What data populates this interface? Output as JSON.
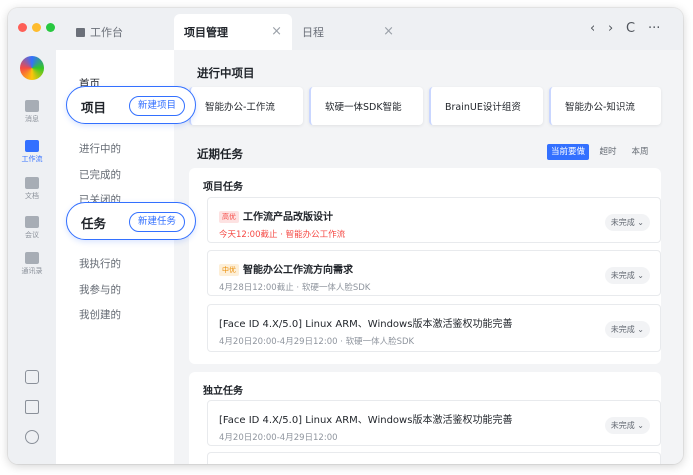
{
  "tabs": [
    {
      "label": "工作台",
      "icon": "grid-icon"
    },
    {
      "label": "项目管理",
      "close": "×"
    },
    {
      "label": "日程",
      "close": "×"
    }
  ],
  "window_controls": {
    "back": "‹",
    "forward": "›",
    "refresh": "C",
    "more": "···"
  },
  "rail": [
    {
      "label": "消息",
      "icon": "message-icon"
    },
    {
      "label": "工作流",
      "icon": "workflow-icon",
      "active": true
    },
    {
      "label": "文档",
      "icon": "doc-icon"
    },
    {
      "label": "会议",
      "icon": "video-icon"
    },
    {
      "label": "通讯录",
      "icon": "contacts-icon"
    }
  ],
  "rail_bottom_icons": [
    "phone-icon",
    "note-icon",
    "more-icon"
  ],
  "nav": {
    "home": "首页",
    "project_group": {
      "title": "项目",
      "button": "新建项目"
    },
    "project_items": [
      "进行中的",
      "已完成的",
      "已关闭的"
    ],
    "task_group": {
      "title": "任务",
      "button": "新建任务"
    },
    "task_items": [
      "我执行的",
      "我参与的",
      "我创建的"
    ]
  },
  "ongoing": {
    "title": "进行中项目",
    "projects": [
      "智能办公-工作流",
      "软硬一体SDK智能",
      "BrainUE设计组资",
      "智能办公-知识流"
    ]
  },
  "recent": {
    "title": "近期任务",
    "filters": [
      "当前要做",
      "超时",
      "本周"
    ],
    "active_filter": "当前要做",
    "project_tasks_title": "项目任务",
    "independent_tasks_title": "独立任务",
    "project_tasks": [
      {
        "priority": "高优",
        "name": "工作流产品改版设计",
        "meta": "今天12:00截止 · 智能办公工作流",
        "status": "未完成 ⌄"
      },
      {
        "priority": "中优",
        "name": "智能办公工作流方向需求",
        "meta": "4月28日12:00截止 · 软硬一体人脸SDK",
        "status": "未完成 ⌄"
      },
      {
        "priority": "",
        "name": "[Face ID 4.X/5.0] Linux ARM、Windows版本激活鉴权功能完善",
        "meta": "4月20日20:00-4月29日12:00 · 软硬一体人脸SDK",
        "status": "未完成 ⌄"
      }
    ],
    "independent_tasks": [
      {
        "name": "[Face ID 4.X/5.0] Linux ARM、Windows版本激活鉴权功能完善",
        "meta": "4月20日20:00-4月29日12:00",
        "status": "未完成 ⌄"
      }
    ]
  },
  "colors": {
    "accent": "#3370ff",
    "red": "#f54a45",
    "bg": "#f3f4f6"
  }
}
